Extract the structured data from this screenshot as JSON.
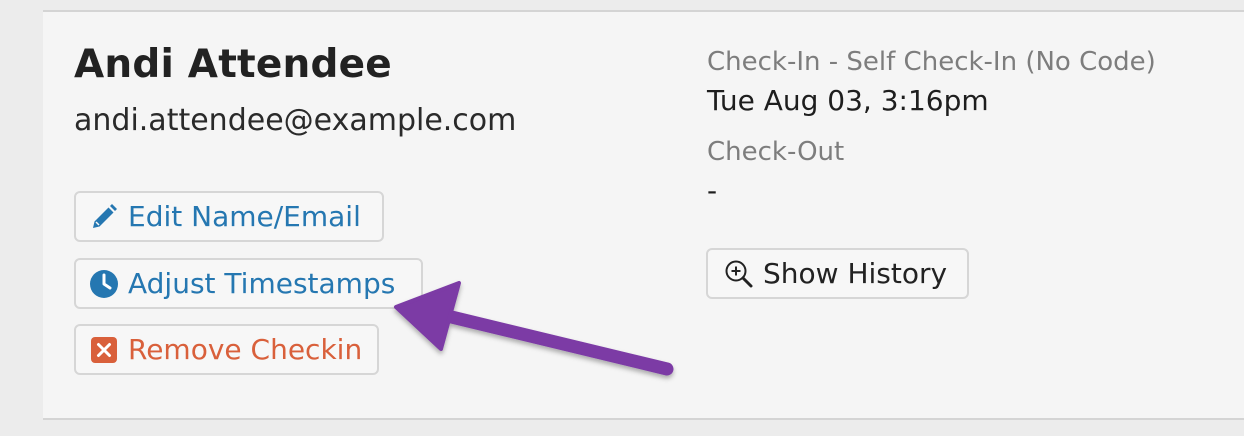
{
  "attendee": {
    "name": "Andi Attendee",
    "email": "andi.attendee@example.com"
  },
  "actions": {
    "edit_label": "Edit Name/Email",
    "adjust_label": "Adjust Timestamps",
    "remove_label": "Remove Checkin",
    "history_label": "Show History"
  },
  "checkin": {
    "label": "Check-In - Self Check-In (No Code)",
    "value": "Tue Aug 03, 3:16pm"
  },
  "checkout": {
    "label": "Check-Out",
    "value": "-"
  },
  "colors": {
    "link_blue": "#2577b1",
    "remove_orange": "#d9603b",
    "annotation_purple": "#7b3aa5"
  },
  "icons": {
    "edit": "pencil-icon",
    "adjust": "clock-icon",
    "remove": "close-box-icon",
    "history": "zoom-in-icon"
  }
}
